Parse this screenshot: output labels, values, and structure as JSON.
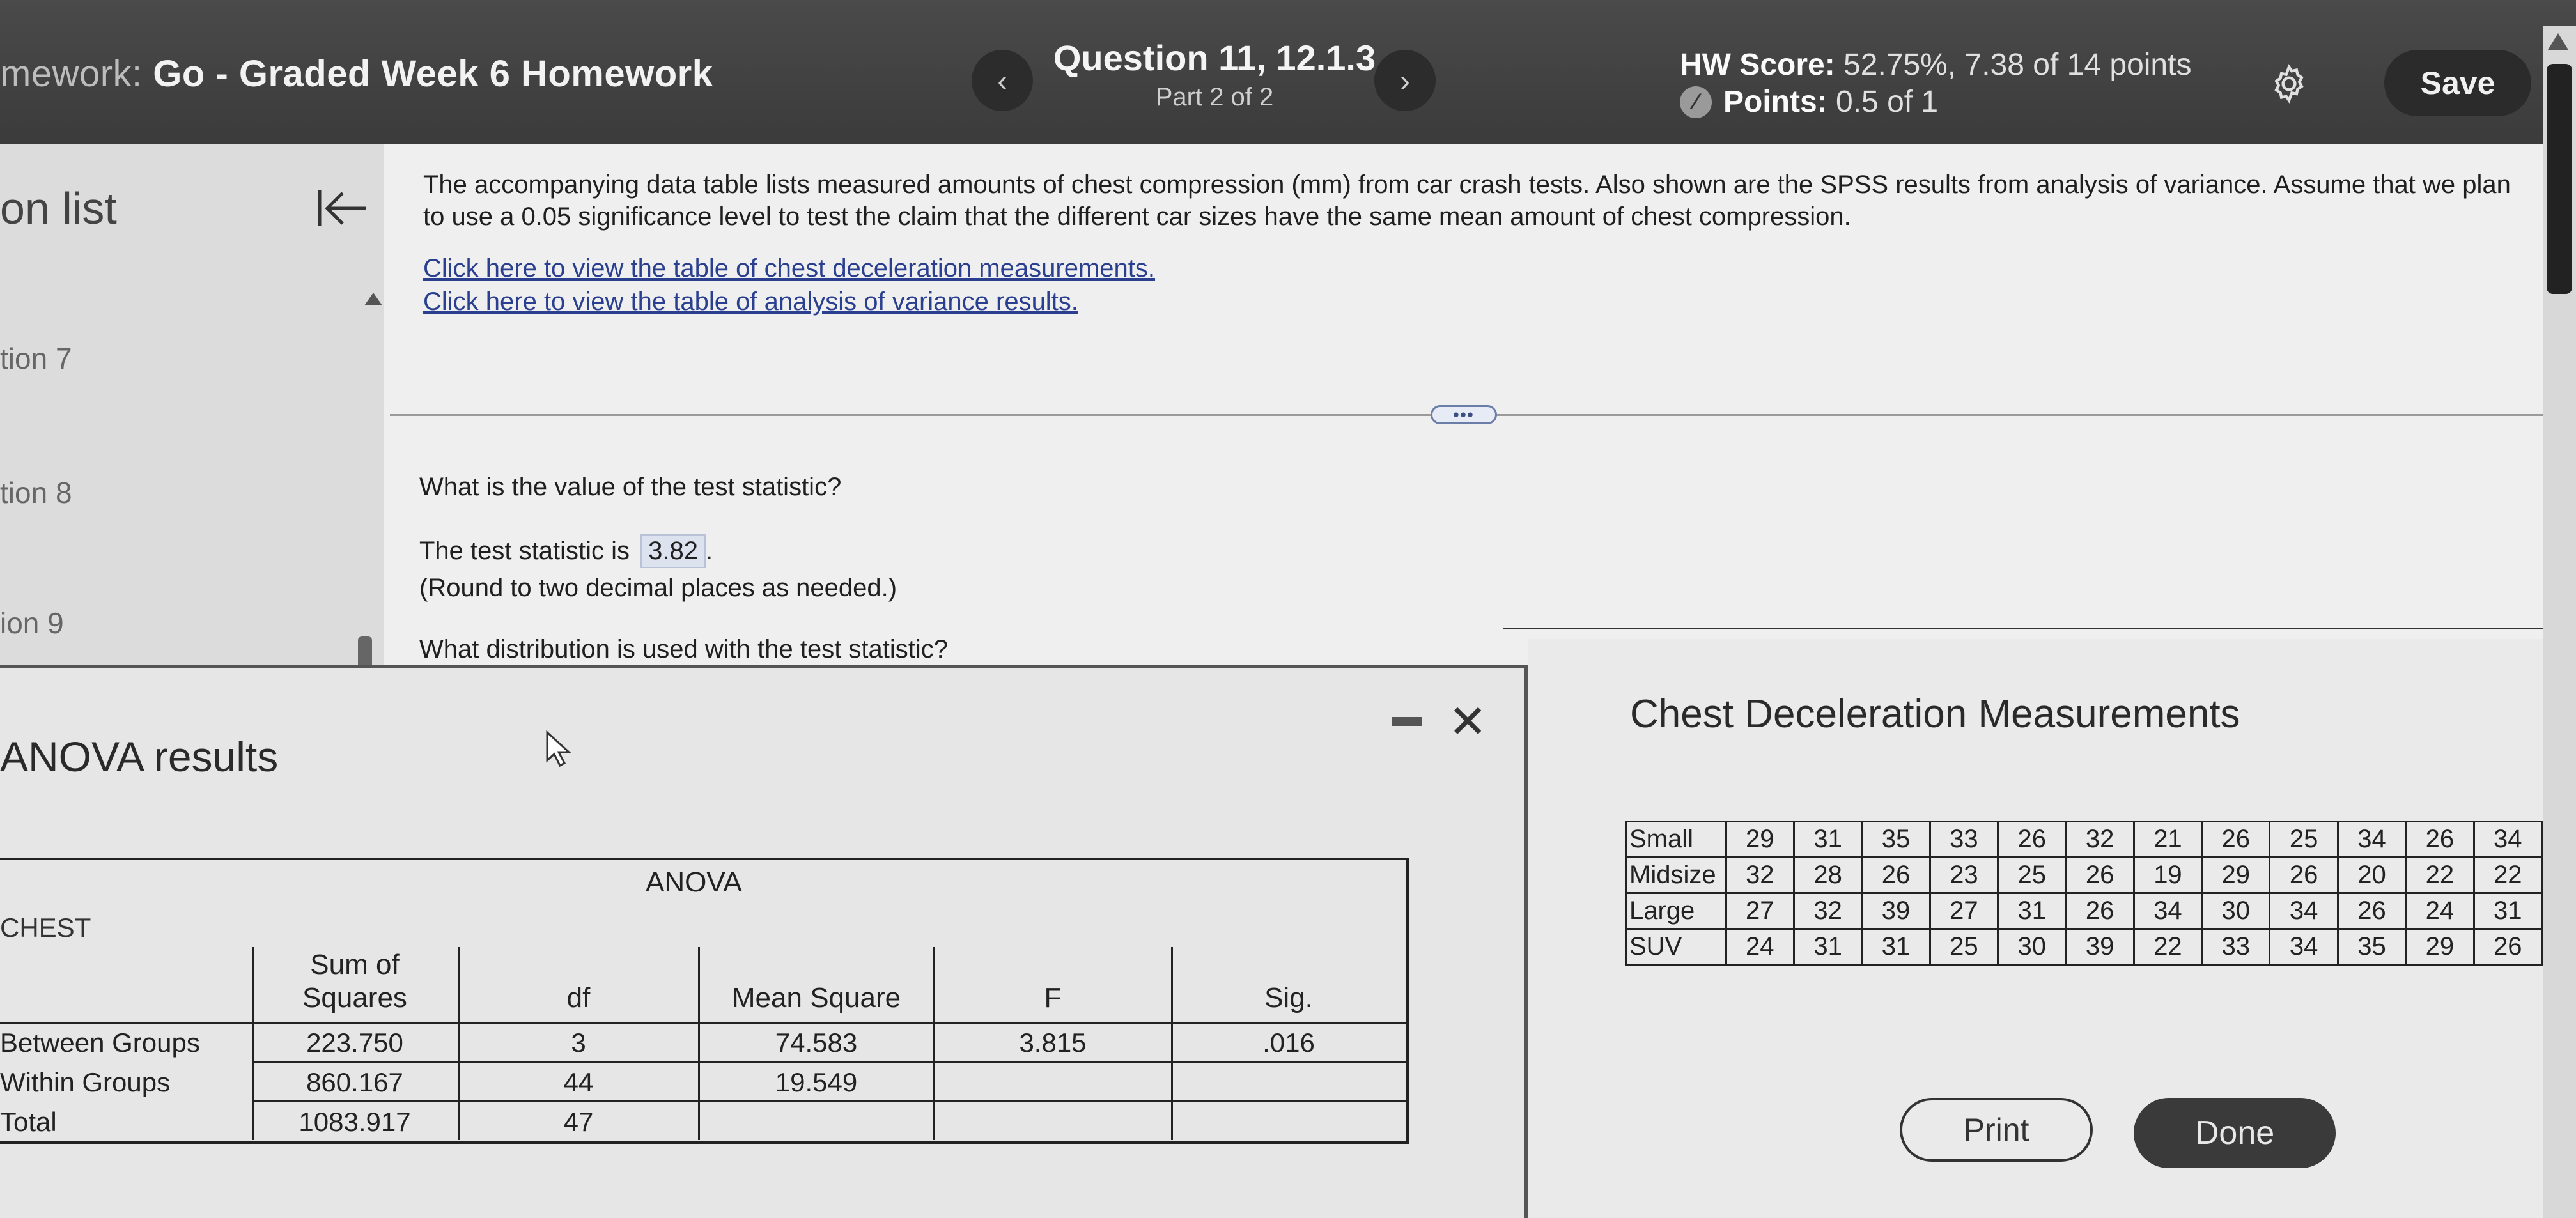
{
  "header": {
    "homework_prefix": "mework:",
    "homework_title": "Go - Graded Week 6 Homework",
    "question_title": "Question 11, 12.1.3",
    "part": "Part 2 of 2",
    "hw_score_label": "HW Score:",
    "hw_score_value": "52.75%, 7.38 of 14 points",
    "points_label": "Points:",
    "points_value": "0.5 of 1",
    "save_label": "Save",
    "prev_icon": "chevron-left-icon",
    "next_icon": "chevron-right-icon",
    "settings_icon": "gear-icon"
  },
  "sidebar": {
    "title": "on list",
    "items": [
      "tion 7",
      "tion 8",
      "ion 9"
    ]
  },
  "question": {
    "intro": "The accompanying data table lists measured amounts of chest compression (mm) from car crash tests. Also shown are the SPSS results from analysis of variance. Assume that we plan to use a 0.05 significance level to test the claim that the different car sizes have the same mean amount of chest compression.",
    "link1": "Click here to view the table of chest deceleration measurements.",
    "link2": "Click here to view the table of analysis of variance results.",
    "q1": "What is the value of the test statistic?",
    "answer_prefix": "The test statistic is",
    "answer_value": "3.82",
    "answer_suffix": ".",
    "hint": "(Round to two decimal places as needed.)",
    "q2": "What distribution is used with the test statistic?"
  },
  "anova_window": {
    "title": "ANOVA results",
    "table_caption": "ANOVA",
    "variable": "CHEST",
    "columns": [
      "Sum of Squares",
      "df",
      "Mean Square",
      "F",
      "Sig."
    ],
    "rows": [
      {
        "label": "Between Groups",
        "ss": "223.750",
        "df": "3",
        "ms": "74.583",
        "f": "3.815",
        "sig": ".016"
      },
      {
        "label": "Within Groups",
        "ss": "860.167",
        "df": "44",
        "ms": "19.549",
        "f": "",
        "sig": ""
      },
      {
        "label": "Total",
        "ss": "1083.917",
        "df": "47",
        "ms": "",
        "f": "",
        "sig": ""
      }
    ]
  },
  "measurements": {
    "title": "Chest Deceleration Measurements",
    "rows": [
      {
        "label": "Small",
        "values": [
          "29",
          "31",
          "35",
          "33",
          "26",
          "32",
          "21",
          "26",
          "25",
          "34",
          "26",
          "34"
        ]
      },
      {
        "label": "Midsize",
        "values": [
          "32",
          "28",
          "26",
          "23",
          "25",
          "26",
          "19",
          "29",
          "26",
          "20",
          "22",
          "22"
        ]
      },
      {
        "label": "Large",
        "values": [
          "27",
          "32",
          "39",
          "27",
          "31",
          "26",
          "34",
          "30",
          "34",
          "26",
          "24",
          "31"
        ]
      },
      {
        "label": "SUV",
        "values": [
          "24",
          "31",
          "31",
          "25",
          "30",
          "39",
          "22",
          "33",
          "34",
          "35",
          "29",
          "26"
        ]
      }
    ],
    "print_label": "Print",
    "done_label": "Done"
  }
}
